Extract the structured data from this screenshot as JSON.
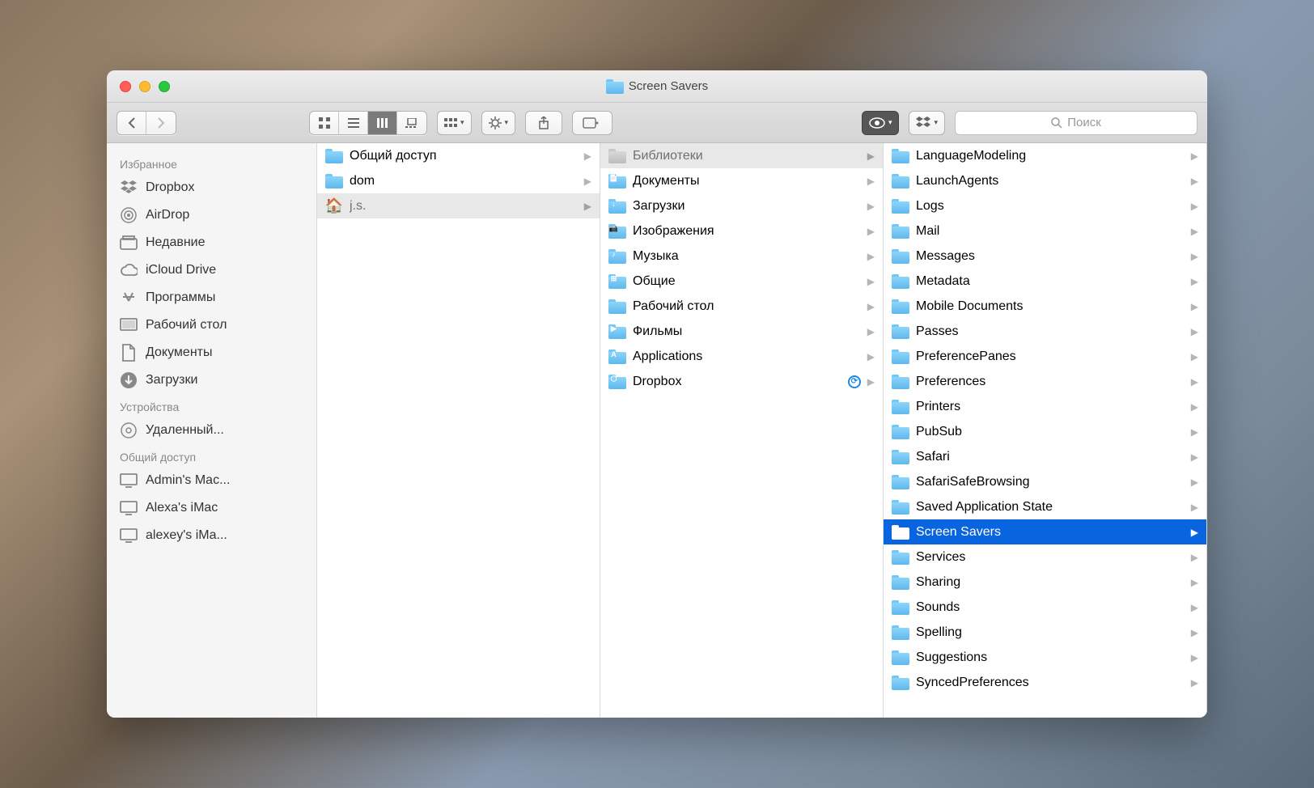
{
  "window": {
    "title": "Screen Savers"
  },
  "search": {
    "placeholder": "Поиск"
  },
  "sidebar": {
    "sections": [
      {
        "title": "Избранное",
        "items": [
          {
            "icon": "dropbox",
            "label": "Dropbox"
          },
          {
            "icon": "airdrop",
            "label": "AirDrop"
          },
          {
            "icon": "recents",
            "label": "Недавние"
          },
          {
            "icon": "icloud",
            "label": "iCloud Drive"
          },
          {
            "icon": "apps",
            "label": "Программы"
          },
          {
            "icon": "desktop",
            "label": "Рабочий стол"
          },
          {
            "icon": "docs",
            "label": "Документы"
          },
          {
            "icon": "downloads",
            "label": "Загрузки"
          }
        ]
      },
      {
        "title": "Устройства",
        "items": [
          {
            "icon": "disc",
            "label": "Удаленный..."
          }
        ]
      },
      {
        "title": "Общий доступ",
        "items": [
          {
            "icon": "mac",
            "label": "Admin's Mac..."
          },
          {
            "icon": "mac",
            "label": "Alexa's iMac"
          },
          {
            "icon": "mac",
            "label": "alexey's iMa..."
          }
        ]
      }
    ]
  },
  "columns": [
    {
      "items": [
        {
          "icon": "folder",
          "label": "Общий доступ",
          "arrow": true
        },
        {
          "icon": "folder",
          "label": "dom",
          "arrow": true
        },
        {
          "icon": "home",
          "label": "j.s.",
          "arrow": true,
          "selpath": true
        }
      ]
    },
    {
      "items": [
        {
          "icon": "folder-grey",
          "label": "Библиотеки",
          "arrow": true,
          "selpath": true
        },
        {
          "icon": "folder",
          "glyph": "📄",
          "label": "Документы",
          "arrow": true
        },
        {
          "icon": "folder",
          "glyph": "↓",
          "label": "Загрузки",
          "arrow": true
        },
        {
          "icon": "folder",
          "glyph": "📷",
          "label": "Изображения",
          "arrow": true
        },
        {
          "icon": "folder",
          "glyph": "♪",
          "label": "Музыка",
          "arrow": true
        },
        {
          "icon": "folder",
          "glyph": "⊞",
          "label": "Общие",
          "arrow": true
        },
        {
          "icon": "folder",
          "glyph": "",
          "label": "Рабочий стол",
          "arrow": true
        },
        {
          "icon": "folder",
          "glyph": "▶",
          "label": "Фильмы",
          "arrow": true
        },
        {
          "icon": "folder",
          "glyph": "A",
          "label": "Applications",
          "arrow": true
        },
        {
          "icon": "folder",
          "glyph": "⬡",
          "label": "Dropbox",
          "arrow": true,
          "sync": true
        }
      ]
    },
    {
      "items": [
        {
          "icon": "folder",
          "label": "LanguageModeling",
          "arrow": true
        },
        {
          "icon": "folder",
          "label": "LaunchAgents",
          "arrow": true
        },
        {
          "icon": "folder",
          "label": "Logs",
          "arrow": true
        },
        {
          "icon": "folder",
          "label": "Mail",
          "arrow": true
        },
        {
          "icon": "folder",
          "label": "Messages",
          "arrow": true
        },
        {
          "icon": "folder",
          "label": "Metadata",
          "arrow": true
        },
        {
          "icon": "folder",
          "label": "Mobile Documents",
          "arrow": true
        },
        {
          "icon": "folder",
          "label": "Passes",
          "arrow": true
        },
        {
          "icon": "folder",
          "label": "PreferencePanes",
          "arrow": true
        },
        {
          "icon": "folder",
          "label": "Preferences",
          "arrow": true
        },
        {
          "icon": "folder",
          "label": "Printers",
          "arrow": true
        },
        {
          "icon": "folder",
          "label": "PubSub",
          "arrow": true
        },
        {
          "icon": "folder",
          "label": "Safari",
          "arrow": true
        },
        {
          "icon": "folder",
          "label": "SafariSafeBrowsing",
          "arrow": true
        },
        {
          "icon": "folder",
          "label": "Saved Application State",
          "arrow": true
        },
        {
          "icon": "folder",
          "label": "Screen Savers",
          "arrow": true,
          "selactive": true
        },
        {
          "icon": "folder",
          "label": "Services",
          "arrow": true
        },
        {
          "icon": "folder",
          "label": "Sharing",
          "arrow": true
        },
        {
          "icon": "folder",
          "label": "Sounds",
          "arrow": true
        },
        {
          "icon": "folder",
          "label": "Spelling",
          "arrow": true
        },
        {
          "icon": "folder",
          "label": "Suggestions",
          "arrow": true
        },
        {
          "icon": "folder",
          "label": "SyncedPreferences",
          "arrow": true
        }
      ]
    }
  ]
}
